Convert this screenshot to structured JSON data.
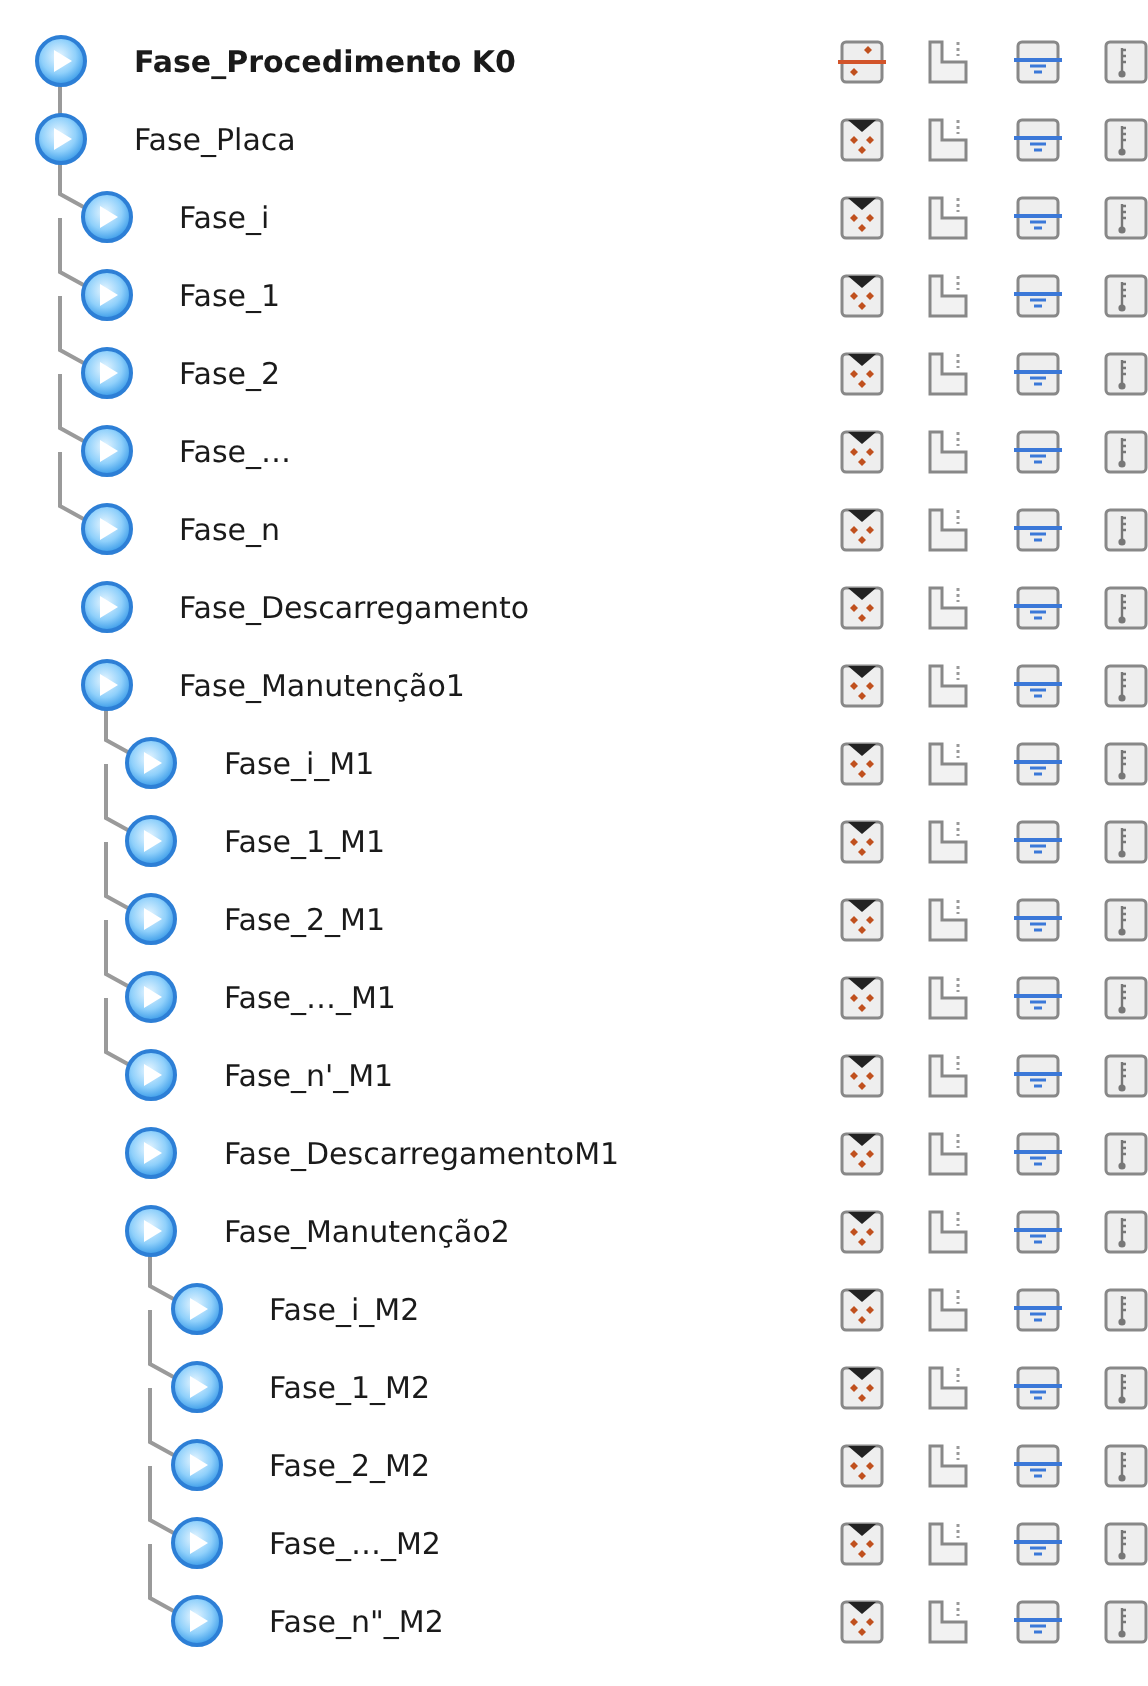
{
  "tree": [
    {
      "label": "Fase_Procedimento K0",
      "kind": "procedure",
      "linked": false
    },
    {
      "label": "Fase_Placa",
      "kind": "phase",
      "linked": true,
      "children": [
        {
          "label": "Fase_i",
          "kind": "phase",
          "linked": true
        },
        {
          "label": "Fase_1",
          "kind": "phase",
          "linked": true
        },
        {
          "label": "Fase_2",
          "kind": "phase",
          "linked": true
        },
        {
          "label": "Fase_…",
          "kind": "phase",
          "linked": true
        },
        {
          "label": "Fase_n",
          "kind": "phase",
          "linked": true
        },
        {
          "label": "Fase_Descarregamento",
          "kind": "phase",
          "linked": false
        },
        {
          "label": "Fase_Manutenção1",
          "kind": "phase",
          "linked": false,
          "children": [
            {
              "label": "Fase_i_M1",
              "kind": "phase",
              "linked": true
            },
            {
              "label": "Fase_1_M1",
              "kind": "phase",
              "linked": true
            },
            {
              "label": "Fase_2_M1",
              "kind": "phase",
              "linked": true
            },
            {
              "label": "Fase_…_M1",
              "kind": "phase",
              "linked": true
            },
            {
              "label": "Fase_n'_M1",
              "kind": "phase",
              "linked": true
            },
            {
              "label": "Fase_DescarregamentoM1",
              "kind": "phase",
              "linked": false
            },
            {
              "label": "Fase_Manutenção2",
              "kind": "phase",
              "linked": false,
              "children": [
                {
                  "label": "Fase_i_M2",
                  "kind": "phase",
                  "linked": true
                },
                {
                  "label": "Fase_1_M2",
                  "kind": "phase",
                  "linked": true
                },
                {
                  "label": "Fase_2_M2",
                  "kind": "phase",
                  "linked": true
                },
                {
                  "label": "Fase_…_M2",
                  "kind": "phase",
                  "linked": true
                },
                {
                  "label": "Fase_n\"_M2",
                  "kind": "phase",
                  "linked": true
                }
              ]
            }
          ]
        }
      ]
    }
  ]
}
